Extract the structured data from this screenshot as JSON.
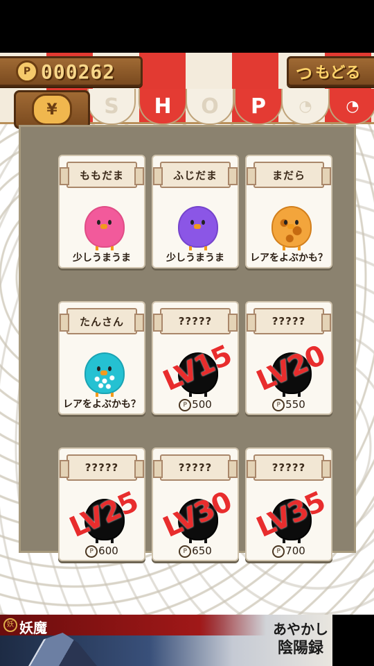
{
  "header": {
    "coin_symbol": "P",
    "coin_count": "000262",
    "back_icon": "つ",
    "back_label": "もどる",
    "purse_symbol": "¥"
  },
  "awning": {
    "letters": [
      "S",
      "H",
      "O",
      "P"
    ]
  },
  "cards": [
    {
      "name": "ももだま",
      "bird": "pink",
      "desc": "少しうまうま",
      "price": "",
      "lv": ""
    },
    {
      "name": "ふじだま",
      "bird": "purple",
      "desc": "少しうまうま",
      "price": "",
      "lv": ""
    },
    {
      "name": "まだら",
      "bird": "mottled",
      "desc": "レアをよぶかも？",
      "price": "",
      "lv": ""
    },
    {
      "name": "たんさん",
      "bird": "cyan",
      "desc": "レアをよぶかも？",
      "price": "",
      "lv": ""
    },
    {
      "name": "?????",
      "bird": "silhouette",
      "desc": "",
      "price": "500",
      "lv": "LV15"
    },
    {
      "name": "?????",
      "bird": "silhouette",
      "desc": "",
      "price": "550",
      "lv": "LV20"
    },
    {
      "name": "?????",
      "bird": "silhouette",
      "desc": "",
      "price": "600",
      "lv": "LV25"
    },
    {
      "name": "?????",
      "bird": "silhouette",
      "desc": "",
      "price": "650",
      "lv": "LV30"
    },
    {
      "name": "?????",
      "bird": "silhouette",
      "desc": "",
      "price": "700",
      "lv": "LV35"
    }
  ],
  "price_coin_symbol": "P",
  "ad": {
    "badge": "妖",
    "left_title": "妖魔",
    "title_line1": "あやかし",
    "title_line2": "陰陽録"
  },
  "colors": {
    "awning_red": "#e43b33",
    "wood": "#8b5a2b",
    "coin_text": "#f8d78a",
    "lv_stamp": "#e82d2d"
  }
}
